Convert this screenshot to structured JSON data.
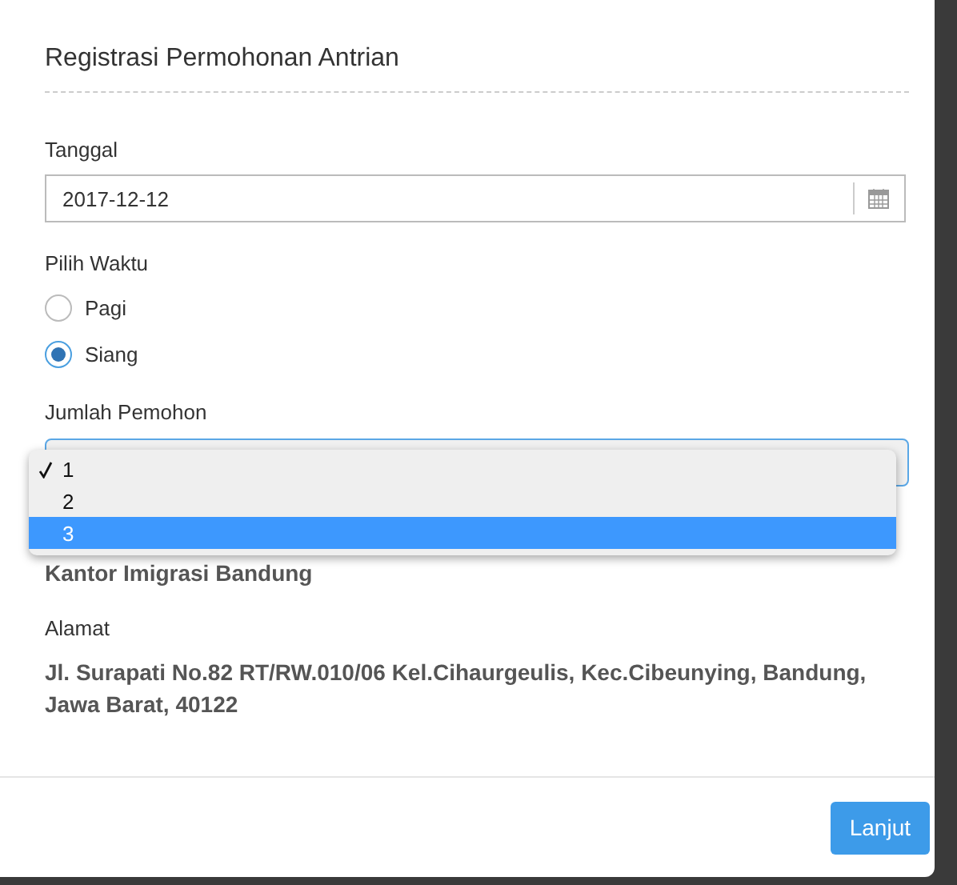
{
  "modal": {
    "title": "Registrasi Permohonan Antrian"
  },
  "date_field": {
    "label": "Tanggal",
    "value": "2017-12-12"
  },
  "time_choice": {
    "label": "Pilih Waktu",
    "options": [
      {
        "label": "Pagi",
        "selected": false
      },
      {
        "label": "Siang",
        "selected": true
      }
    ]
  },
  "applicant_count": {
    "label": "Jumlah Pemohon",
    "options": [
      {
        "label": "1",
        "checked": true,
        "highlighted": false
      },
      {
        "label": "2",
        "checked": false,
        "highlighted": false
      },
      {
        "label": "3",
        "checked": false,
        "highlighted": true
      }
    ]
  },
  "office": {
    "name": "Kantor Imigrasi Bandung"
  },
  "address": {
    "label": "Alamat",
    "value": "Jl. Surapati No.82 RT/RW.010/06 Kel.Cihaurgeulis, Kec.Cibeunying, Bandung, Jawa Barat, 40122"
  },
  "buttons": [
    {
      "label": "Lanjut"
    }
  ]
}
